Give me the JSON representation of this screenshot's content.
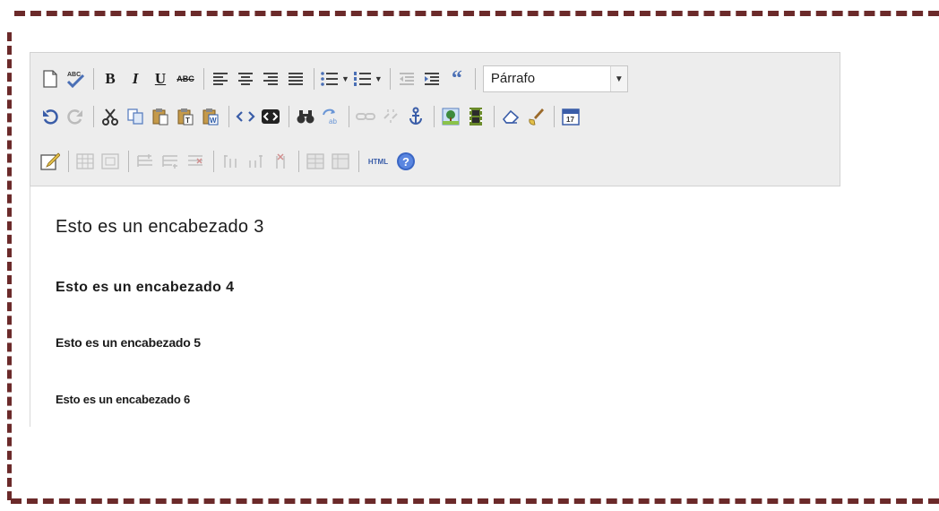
{
  "colors": {
    "frame": "#6b2a2a",
    "toolbar_bg": "#ededed",
    "editor_bg": "#ffffff"
  },
  "toolbar": {
    "bold_label": "B",
    "italic_label": "I",
    "underline_label": "U",
    "strike_label": "ABC",
    "spellcheck_label": "ABC",
    "html_label": "HTML",
    "blockquote_label": "“",
    "format_select": {
      "value": "Párrafo"
    }
  },
  "content": {
    "headings": [
      "Esto es un encabezado 3",
      "Esto es un encabezado 4",
      "Esto es un encabezado 5",
      "Esto es un encabezado 6"
    ]
  }
}
